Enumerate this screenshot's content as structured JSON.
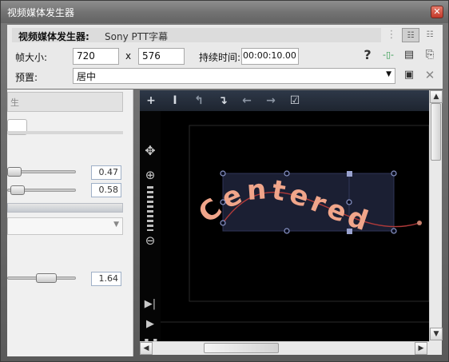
{
  "window": {
    "title": "视频媒体发生器",
    "close_glyph": "✕"
  },
  "header": {
    "generator_label": "视频媒体发生器:",
    "generator_name": "Sony PTT字幕",
    "frame_size_label": "帧大小:",
    "width_value": "720",
    "times_glyph": "x",
    "height_value": "576",
    "duration_label": "持续时间:",
    "duration_value": "00:00:10.00",
    "preset_label": "预置:",
    "preset_value": "居中"
  },
  "left_panel": {
    "tab_fragment": "生",
    "slider_values": [
      "0.47",
      "0.58",
      "1.64"
    ]
  },
  "canvas": {
    "toolbar_icons": [
      "plus-icon",
      "text-cursor-icon",
      "curve-up-icon",
      "curve-down-icon",
      "arrow-left-icon",
      "arrow-right-icon",
      "checkbox-icon"
    ],
    "preview_text": "Centered",
    "accent_text_color": "#f0a58a"
  }
}
